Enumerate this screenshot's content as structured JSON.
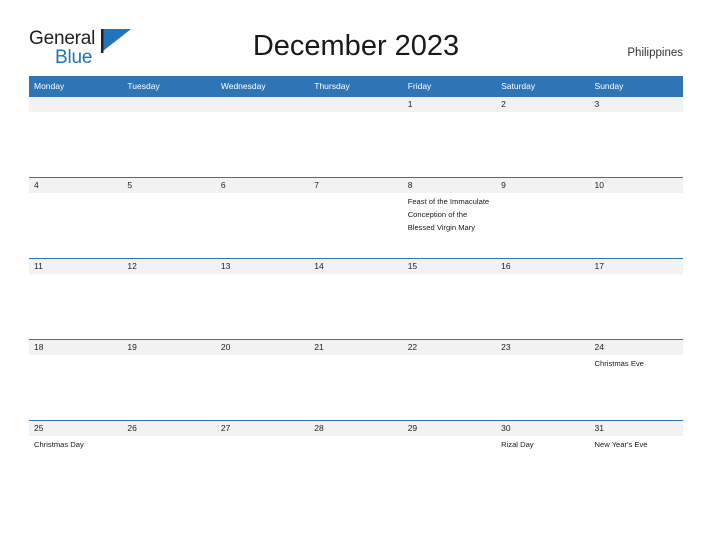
{
  "logo": {
    "word_top": "General",
    "word_bottom": "Blue",
    "flag_icon": "blue-flag-triangle",
    "blue": "#2273b9"
  },
  "header": {
    "title": "December 2023",
    "country": "Philippines"
  },
  "theme": {
    "header_blue": "#2e75b6",
    "band_gray": "#f2f2f2",
    "text_dark": "#222222",
    "white": "#ffffff"
  },
  "calendar": {
    "day_names": [
      "Monday",
      "Tuesday",
      "Wednesday",
      "Thursday",
      "Friday",
      "Saturday",
      "Sunday"
    ],
    "weeks": [
      {
        "days": [
          {
            "num": "",
            "event": ""
          },
          {
            "num": "",
            "event": ""
          },
          {
            "num": "",
            "event": ""
          },
          {
            "num": "",
            "event": ""
          },
          {
            "num": "1",
            "event": ""
          },
          {
            "num": "2",
            "event": ""
          },
          {
            "num": "3",
            "event": ""
          }
        ]
      },
      {
        "days": [
          {
            "num": "4",
            "event": ""
          },
          {
            "num": "5",
            "event": ""
          },
          {
            "num": "6",
            "event": ""
          },
          {
            "num": "7",
            "event": ""
          },
          {
            "num": "8",
            "event": "Feast of the Immaculate Conception of the Blessed Virgin Mary"
          },
          {
            "num": "9",
            "event": ""
          },
          {
            "num": "10",
            "event": ""
          }
        ]
      },
      {
        "days": [
          {
            "num": "11",
            "event": ""
          },
          {
            "num": "12",
            "event": ""
          },
          {
            "num": "13",
            "event": ""
          },
          {
            "num": "14",
            "event": ""
          },
          {
            "num": "15",
            "event": ""
          },
          {
            "num": "16",
            "event": ""
          },
          {
            "num": "17",
            "event": ""
          }
        ]
      },
      {
        "days": [
          {
            "num": "18",
            "event": ""
          },
          {
            "num": "19",
            "event": ""
          },
          {
            "num": "20",
            "event": ""
          },
          {
            "num": "21",
            "event": ""
          },
          {
            "num": "22",
            "event": ""
          },
          {
            "num": "23",
            "event": ""
          },
          {
            "num": "24",
            "event": "Christmas Eve"
          }
        ]
      },
      {
        "days": [
          {
            "num": "25",
            "event": "Christmas Day"
          },
          {
            "num": "26",
            "event": ""
          },
          {
            "num": "27",
            "event": ""
          },
          {
            "num": "28",
            "event": ""
          },
          {
            "num": "29",
            "event": ""
          },
          {
            "num": "30",
            "event": "Rizal Day"
          },
          {
            "num": "31",
            "event": "New Year's Eve"
          }
        ]
      }
    ]
  }
}
